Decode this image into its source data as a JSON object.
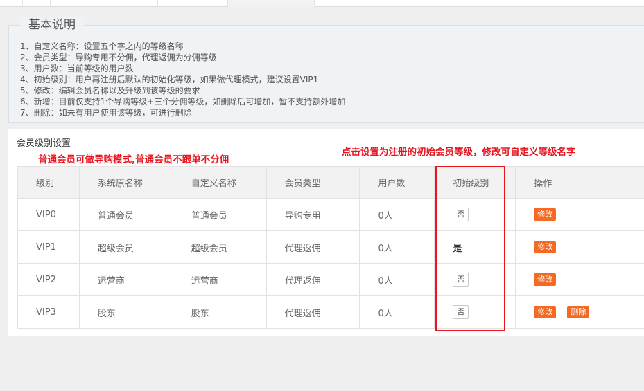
{
  "info": {
    "title": "基本说明",
    "lines": [
      "1、自定义名称：设置五个字之内的等级名称",
      "2、会员类型：导购专用不分佣，代理返佣为分佣等级",
      "3、用户数：当前等级的用户数",
      "4、初始级别：用户再注册后默认的初始化等级，如果做代理模式，建议设置VIP1",
      "5、修改：编辑会员名称以及升级到该等级的要求",
      "6、新增：目前仅支持1个导购等级+三个分佣等级，如删除后可增加，暂不支持额外增加",
      "7、删除：如未有用户使用该等级，可进行删除"
    ]
  },
  "panel": {
    "title": "会员级别设置",
    "note_left": "普通会员可做导购模式,普通会员不跟单不分佣",
    "note_right": "点击设置为注册的初始会员等级，修改可自定义等级名字"
  },
  "table": {
    "headers": [
      "级别",
      "系统原名称",
      "自定义名称",
      "会员类型",
      "用户数",
      "初始级别",
      "操作"
    ],
    "rows": [
      {
        "level": "VIP0",
        "sys_name": "普通会员",
        "custom_name": "普通会员",
        "type": "导购专用",
        "users": "0人",
        "initial": "否",
        "initial_is_default": false,
        "edit": "修改"
      },
      {
        "level": "VIP1",
        "sys_name": "超级会员",
        "custom_name": "超级会员",
        "type": "代理返佣",
        "users": "0人",
        "initial": "是",
        "initial_is_default": true,
        "edit": "修改"
      },
      {
        "level": "VIP2",
        "sys_name": "运营商",
        "custom_name": "运营商",
        "type": "代理返佣",
        "users": "0人",
        "initial": "否",
        "initial_is_default": false,
        "edit": "修改"
      },
      {
        "level": "VIP3",
        "sys_name": "股东",
        "custom_name": "股东",
        "type": "代理返佣",
        "users": "0人",
        "initial": "否",
        "initial_is_default": false,
        "edit": "修改",
        "delete": "删除"
      }
    ]
  },
  "colors": {
    "accent_orange": "#f46a25",
    "annotation_red": "#e8141e"
  }
}
